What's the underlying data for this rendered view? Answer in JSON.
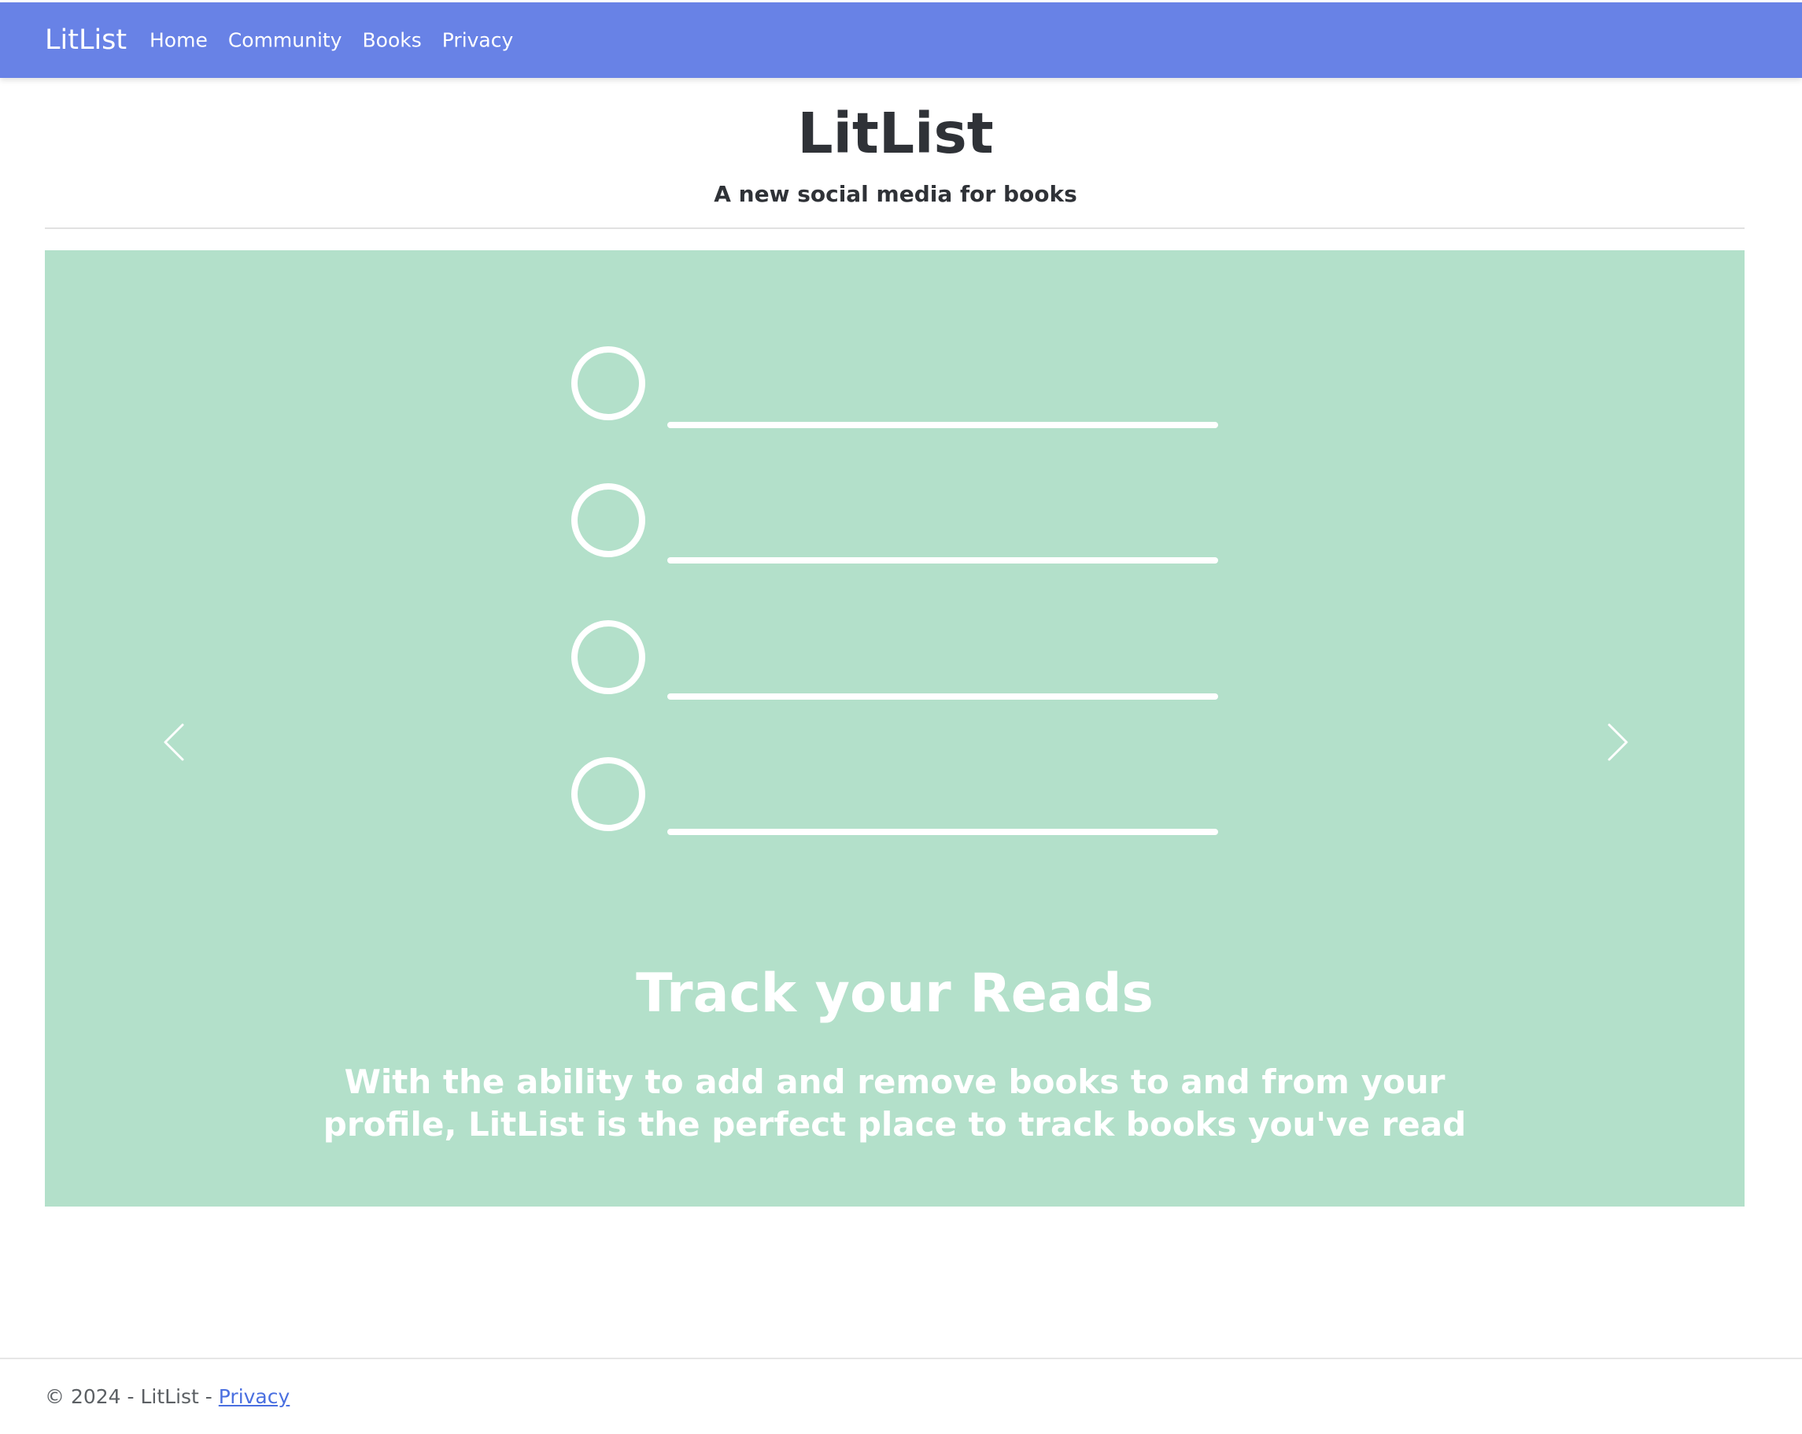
{
  "navbar": {
    "brand": "LitList",
    "links": [
      "Home",
      "Community",
      "Books",
      "Privacy"
    ],
    "background_color": "#6882e6"
  },
  "hero": {
    "title": "LitList",
    "subtitle": "A new social media for books"
  },
  "carousel": {
    "background_color": "#b3e0ca",
    "slide_graphic": "checklist-illustration",
    "checklist_items": 4,
    "caption_title": "Track your Reads",
    "caption_text": "With the ability to add and remove books to and from your profile, LitList is the perfect place to track books you've read",
    "prev_icon": "chevron-left-icon",
    "next_icon": "chevron-right-icon"
  },
  "footer": {
    "copyright": "© 2024 - LitList - ",
    "privacy_link": "Privacy"
  }
}
